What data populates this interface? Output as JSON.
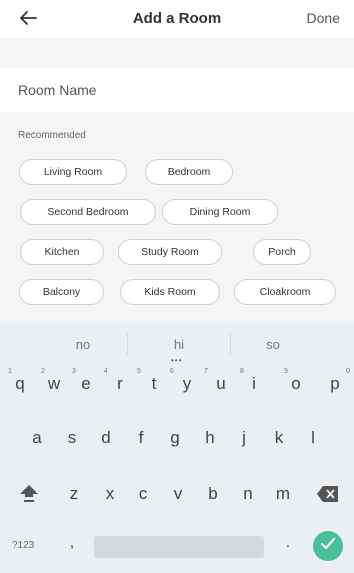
{
  "header": {
    "title": "Add a Room",
    "done_label": "Done"
  },
  "room_name": {
    "placeholder": "Room Name"
  },
  "recommended": {
    "label": "Recommended",
    "chips": [
      "Living Room",
      "Bedroom",
      "Second Bedroom",
      "Dining Room",
      "Kitchen",
      "Study Room",
      "Porch",
      "Balcony",
      "Kids Room",
      "Cloakroom"
    ]
  },
  "keyboard": {
    "suggestions": [
      "no",
      "hi",
      "so"
    ],
    "row1": [
      "q",
      "w",
      "e",
      "r",
      "t",
      "y",
      "u",
      "i",
      "o",
      "p"
    ],
    "row1_numbers": [
      "1",
      "2",
      "3",
      "4",
      "5",
      "6",
      "7",
      "8",
      "9",
      "0"
    ],
    "row2": [
      "a",
      "s",
      "d",
      "f",
      "g",
      "h",
      "j",
      "k",
      "l"
    ],
    "row3": [
      "z",
      "x",
      "c",
      "v",
      "b",
      "n",
      "m"
    ],
    "symbols_label": "?123",
    "comma": ",",
    "period": ".",
    "enter_color": "#4bbf9a"
  },
  "icons": {
    "back": "arrow-left-icon",
    "shift": "shift-icon",
    "backspace": "backspace-icon",
    "enter": "check-icon"
  }
}
